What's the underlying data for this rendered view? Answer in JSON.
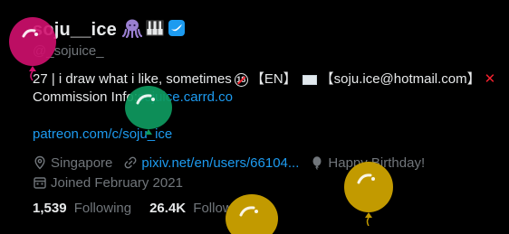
{
  "profile": {
    "display_name": "soju__ice",
    "handle": "@_sojuice_",
    "name_icons": [
      "octopus-icon",
      "piano-keys-icon",
      "verified-icon"
    ]
  },
  "bio": {
    "line1_prefix": "27 | i draw what i like, sometimes",
    "age_badge": "18",
    "lang_tag": "【EN】",
    "email_open": "【 ",
    "email": "soju.ice@hotmail.com",
    "email_close": " 】",
    "line2_prefix": "Commission Info: ",
    "carrd_link": "sojuice.carrd.co"
  },
  "patreon_link": "patreon.com/c/soju_ice",
  "meta": {
    "location": "Singapore",
    "website": "pixiv.net/en/users/66104...",
    "birthday": "Happy Birthday!",
    "joined": "Joined February 2021"
  },
  "stats": {
    "following_count": "1,539",
    "following_label": "Following",
    "followers_count": "26.4K",
    "followers_label": "Followers"
  },
  "colors": {
    "background": "#000000",
    "text": "#e7e9ea",
    "muted": "#71767b",
    "link": "#1d9bf0",
    "balloon_pink": "#d0106e",
    "balloon_green": "#0e9a5f",
    "balloon_gold": "#c29a00"
  }
}
